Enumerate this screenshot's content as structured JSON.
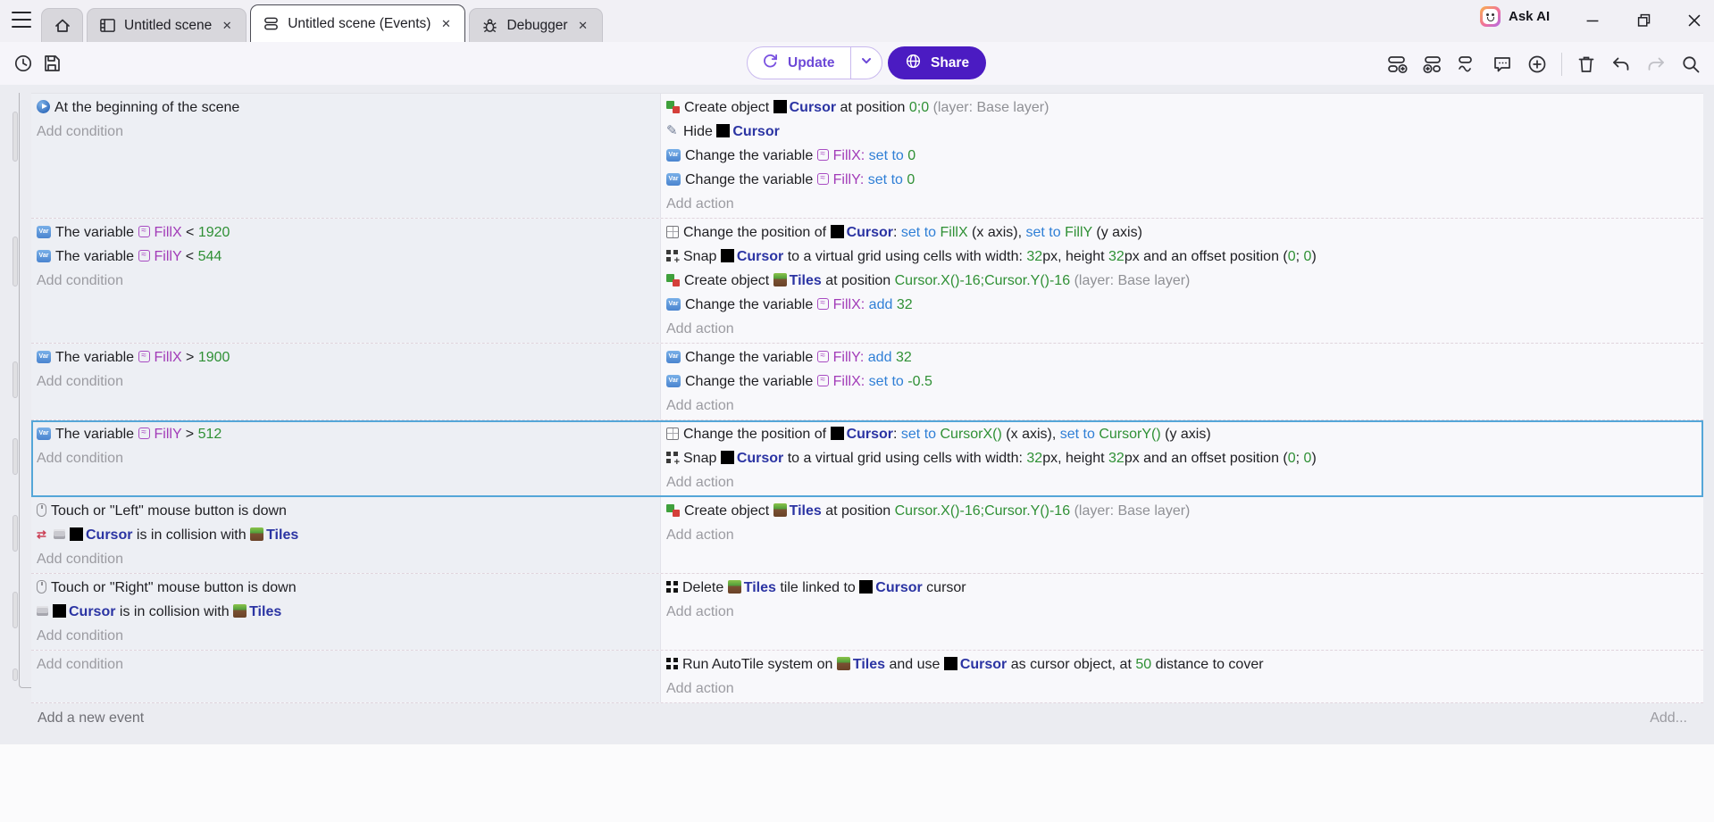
{
  "titlebar": {
    "ask_ai_label": "Ask AI",
    "tabs": [
      {
        "label": "Untitled scene"
      },
      {
        "label": "Untitled scene (Events)"
      },
      {
        "label": "Debugger"
      }
    ]
  },
  "toolbar": {
    "update_label": "Update",
    "share_label": "Share"
  },
  "labels": {
    "add_condition": "Add condition",
    "add_action": "Add action",
    "add_new_event": "Add a new event",
    "add_more": "Add..."
  },
  "colors": {
    "object_blue": "#2b34a3",
    "variable_purple": "#a23cb8",
    "operator_blue": "#2f7fd6",
    "value_green": "#2f9035",
    "muted_gray": "#8f9095",
    "selected_border": "#54a6d8",
    "share_button_bg": "#4b1bc2",
    "update_purple": "#6d49d7"
  },
  "events": [
    {
      "selected": false,
      "conditions": [
        [
          [
            "i",
            "play"
          ],
          [
            "p",
            "At the beginning of the scene"
          ]
        ]
      ],
      "actions": [
        [
          [
            "i",
            "create"
          ],
          [
            "p",
            "Create object "
          ],
          [
            "i",
            "cursor"
          ],
          [
            "o",
            "Cursor"
          ],
          [
            "p",
            " at position "
          ],
          [
            "g",
            "0;0"
          ],
          [
            "p",
            " "
          ],
          [
            "gr",
            "(layer: Base layer)"
          ]
        ],
        [
          [
            "i",
            "hide"
          ],
          [
            "p",
            "Hide "
          ],
          [
            "i",
            "cursor"
          ],
          [
            "o",
            "Cursor"
          ]
        ],
        [
          [
            "i",
            "varblue"
          ],
          [
            "p",
            "Change the variable "
          ],
          [
            "i",
            "vartag"
          ],
          [
            "v",
            "FillX:"
          ],
          [
            "p",
            " "
          ],
          [
            "op",
            "set to"
          ],
          [
            "p",
            " "
          ],
          [
            "g",
            "0"
          ]
        ],
        [
          [
            "i",
            "varblue"
          ],
          [
            "p",
            "Change the variable "
          ],
          [
            "i",
            "vartag"
          ],
          [
            "v",
            "FillY:"
          ],
          [
            "p",
            " "
          ],
          [
            "op",
            "set to"
          ],
          [
            "p",
            " "
          ],
          [
            "g",
            "0"
          ]
        ]
      ]
    },
    {
      "selected": false,
      "conditions": [
        [
          [
            "i",
            "varblue"
          ],
          [
            "p",
            "The variable "
          ],
          [
            "i",
            "vartag"
          ],
          [
            "v",
            "FillX"
          ],
          [
            "p",
            " < "
          ],
          [
            "g",
            "1920"
          ]
        ],
        [
          [
            "i",
            "varblue"
          ],
          [
            "p",
            "The variable "
          ],
          [
            "i",
            "vartag"
          ],
          [
            "v",
            "FillY"
          ],
          [
            "p",
            " < "
          ],
          [
            "g",
            "544"
          ]
        ]
      ],
      "actions": [
        [
          [
            "i",
            "position"
          ],
          [
            "p",
            "Change the position of "
          ],
          [
            "i",
            "cursor"
          ],
          [
            "o",
            "Cursor"
          ],
          [
            "p",
            ": "
          ],
          [
            "op",
            "set to"
          ],
          [
            "p",
            " "
          ],
          [
            "g",
            "FillX"
          ],
          [
            "p",
            " (x axis), "
          ],
          [
            "op",
            "set to"
          ],
          [
            "p",
            " "
          ],
          [
            "g",
            "FillY"
          ],
          [
            "p",
            " (y axis)"
          ]
        ],
        [
          [
            "i",
            "snap"
          ],
          [
            "p",
            "Snap "
          ],
          [
            "i",
            "cursor"
          ],
          [
            "o",
            "Cursor"
          ],
          [
            "p",
            " to a virtual grid using cells with width: "
          ],
          [
            "g",
            "32"
          ],
          [
            "p",
            "px, height "
          ],
          [
            "g",
            "32"
          ],
          [
            "p",
            "px and an offset position ("
          ],
          [
            "g",
            "0"
          ],
          [
            "p",
            "; "
          ],
          [
            "g",
            "0"
          ],
          [
            "p",
            ")"
          ]
        ],
        [
          [
            "i",
            "create"
          ],
          [
            "p",
            "Create object "
          ],
          [
            "i",
            "tiles"
          ],
          [
            "o",
            "Tiles"
          ],
          [
            "p",
            " at position "
          ],
          [
            "g",
            "Cursor.X()-16;Cursor.Y()-16"
          ],
          [
            "p",
            " "
          ],
          [
            "gr",
            "(layer: Base layer)"
          ]
        ],
        [
          [
            "i",
            "varblue"
          ],
          [
            "p",
            "Change the variable "
          ],
          [
            "i",
            "vartag"
          ],
          [
            "v",
            "FillX:"
          ],
          [
            "p",
            " "
          ],
          [
            "op",
            "add"
          ],
          [
            "p",
            " "
          ],
          [
            "g",
            "32"
          ]
        ]
      ]
    },
    {
      "selected": false,
      "conditions": [
        [
          [
            "i",
            "varblue"
          ],
          [
            "p",
            "The variable "
          ],
          [
            "i",
            "vartag"
          ],
          [
            "v",
            "FillX"
          ],
          [
            "p",
            " > "
          ],
          [
            "g",
            "1900"
          ]
        ]
      ],
      "actions": [
        [
          [
            "i",
            "varblue"
          ],
          [
            "p",
            "Change the variable "
          ],
          [
            "i",
            "vartag"
          ],
          [
            "v",
            "FillY:"
          ],
          [
            "p",
            " "
          ],
          [
            "op",
            "add"
          ],
          [
            "p",
            " "
          ],
          [
            "g",
            "32"
          ]
        ],
        [
          [
            "i",
            "varblue"
          ],
          [
            "p",
            "Change the variable "
          ],
          [
            "i",
            "vartag"
          ],
          [
            "v",
            "FillX:"
          ],
          [
            "p",
            " "
          ],
          [
            "op",
            "set to"
          ],
          [
            "p",
            " "
          ],
          [
            "g",
            "-0.5"
          ]
        ]
      ]
    },
    {
      "selected": true,
      "conditions": [
        [
          [
            "i",
            "varblue"
          ],
          [
            "p",
            "The variable "
          ],
          [
            "i",
            "vartag"
          ],
          [
            "v",
            "FillY"
          ],
          [
            "p",
            " > "
          ],
          [
            "g",
            "512"
          ]
        ]
      ],
      "actions": [
        [
          [
            "i",
            "position"
          ],
          [
            "p",
            "Change the position of "
          ],
          [
            "i",
            "cursor"
          ],
          [
            "o",
            "Cursor"
          ],
          [
            "p",
            ": "
          ],
          [
            "op",
            "set to"
          ],
          [
            "p",
            " "
          ],
          [
            "g",
            "CursorX()"
          ],
          [
            "p",
            " (x axis), "
          ],
          [
            "op",
            "set to"
          ],
          [
            "p",
            " "
          ],
          [
            "g",
            "CursorY()"
          ],
          [
            "p",
            " (y axis)"
          ]
        ],
        [
          [
            "i",
            "snap"
          ],
          [
            "p",
            "Snap "
          ],
          [
            "i",
            "cursor"
          ],
          [
            "o",
            "Cursor"
          ],
          [
            "p",
            " to a virtual grid using cells with width: "
          ],
          [
            "g",
            "32"
          ],
          [
            "p",
            "px, height "
          ],
          [
            "g",
            "32"
          ],
          [
            "p",
            "px and an offset position ("
          ],
          [
            "g",
            "0"
          ],
          [
            "p",
            "; "
          ],
          [
            "g",
            "0"
          ],
          [
            "p",
            ")"
          ]
        ]
      ]
    },
    {
      "selected": false,
      "conditions": [
        [
          [
            "i",
            "mouse"
          ],
          [
            "p",
            "Touch or \"Left\" mouse button is down"
          ]
        ],
        [
          [
            "i",
            "collide"
          ],
          [
            "i",
            "brick"
          ],
          [
            "i",
            "cursor"
          ],
          [
            "o",
            "Cursor"
          ],
          [
            "p",
            " is in collision with "
          ],
          [
            "i",
            "tiles"
          ],
          [
            "o",
            "Tiles"
          ]
        ]
      ],
      "actions": [
        [
          [
            "i",
            "create"
          ],
          [
            "p",
            "Create object "
          ],
          [
            "i",
            "tiles"
          ],
          [
            "o",
            "Tiles"
          ],
          [
            "p",
            " at position "
          ],
          [
            "g",
            "Cursor.X()-16;Cursor.Y()-16"
          ],
          [
            "p",
            " "
          ],
          [
            "gr",
            "(layer: Base layer)"
          ]
        ]
      ]
    },
    {
      "selected": false,
      "conditions": [
        [
          [
            "i",
            "mouse"
          ],
          [
            "p",
            "Touch or \"Right\" mouse button is down"
          ]
        ],
        [
          [
            "i",
            "brick"
          ],
          [
            "i",
            "cursor"
          ],
          [
            "o",
            "Cursor"
          ],
          [
            "p",
            " is in collision with "
          ],
          [
            "i",
            "tiles"
          ],
          [
            "o",
            "Tiles"
          ]
        ]
      ],
      "actions": [
        [
          [
            "i",
            "grid"
          ],
          [
            "p",
            "Delete "
          ],
          [
            "i",
            "tiles"
          ],
          [
            "o",
            "Tiles"
          ],
          [
            "p",
            " tile linked to "
          ],
          [
            "i",
            "cursor"
          ],
          [
            "o",
            "Cursor"
          ],
          [
            "p",
            " cursor"
          ]
        ]
      ]
    },
    {
      "selected": false,
      "conditions": [],
      "actions": [
        [
          [
            "i",
            "grid"
          ],
          [
            "p",
            "Run AutoTile system on "
          ],
          [
            "i",
            "tiles"
          ],
          [
            "o",
            "Tiles"
          ],
          [
            "p",
            " and use "
          ],
          [
            "i",
            "cursor"
          ],
          [
            "o",
            "Cursor"
          ],
          [
            "p",
            " as cursor object, at "
          ],
          [
            "g",
            "50"
          ],
          [
            "p",
            " distance to cover"
          ]
        ]
      ]
    }
  ]
}
